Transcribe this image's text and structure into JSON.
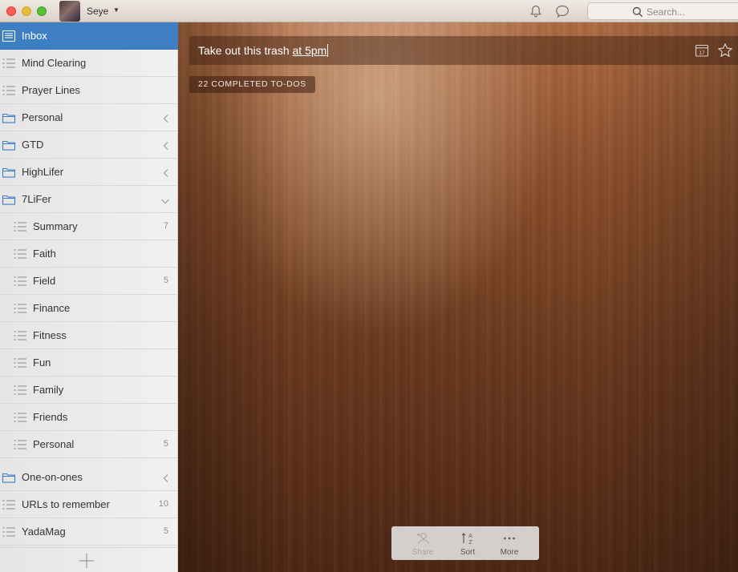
{
  "titlebar": {
    "username": "Seye",
    "search_placeholder": "Search..."
  },
  "sidebar": {
    "items": [
      {
        "label": "Inbox",
        "icon": "inbox-icon",
        "active": true
      },
      {
        "label": "Mind Clearing",
        "icon": "list-icon"
      },
      {
        "label": "Prayer Lines",
        "icon": "list-icon"
      },
      {
        "label": "Personal",
        "icon": "folder-icon",
        "chevron": "left"
      },
      {
        "label": "GTD",
        "icon": "folder-icon",
        "chevron": "left"
      },
      {
        "label": "HighLifer",
        "icon": "folder-icon",
        "chevron": "left"
      },
      {
        "label": "7LiFer",
        "icon": "folder-icon",
        "chevron": "down"
      },
      {
        "label": "Summary",
        "icon": "list-icon",
        "count": "7",
        "indent": true
      },
      {
        "label": "Faith",
        "icon": "list-icon",
        "indent": true
      },
      {
        "label": "Field",
        "icon": "list-icon",
        "count": "5",
        "indent": true
      },
      {
        "label": "Finance",
        "icon": "list-icon",
        "indent": true
      },
      {
        "label": "Fitness",
        "icon": "list-icon",
        "indent": true
      },
      {
        "label": "Fun",
        "icon": "list-icon",
        "indent": true
      },
      {
        "label": "Family",
        "icon": "list-icon",
        "indent": true
      },
      {
        "label": "Friends",
        "icon": "list-icon",
        "indent": true
      },
      {
        "label": "Personal",
        "icon": "list-icon",
        "count": "5",
        "indent": true
      },
      {
        "label": "One-on-ones",
        "icon": "folder-icon",
        "chevron": "left"
      },
      {
        "label": "URLs to remember",
        "icon": "list-icon",
        "count": "10"
      },
      {
        "label": "YadaMag",
        "icon": "list-icon",
        "count": "5"
      }
    ]
  },
  "main": {
    "todo_input": {
      "value_text": "Take out this trash ",
      "value_highlight": "at 5pm",
      "calendar_day": "17"
    },
    "completed_label": "22 COMPLETED TO-DOS",
    "bottom_bar": {
      "share_label": "Share",
      "sort_label": "Sort",
      "more_label": "More"
    }
  },
  "colors": {
    "active_blue": "#3e7fc3",
    "folder_blue": "#3e7fc3"
  }
}
